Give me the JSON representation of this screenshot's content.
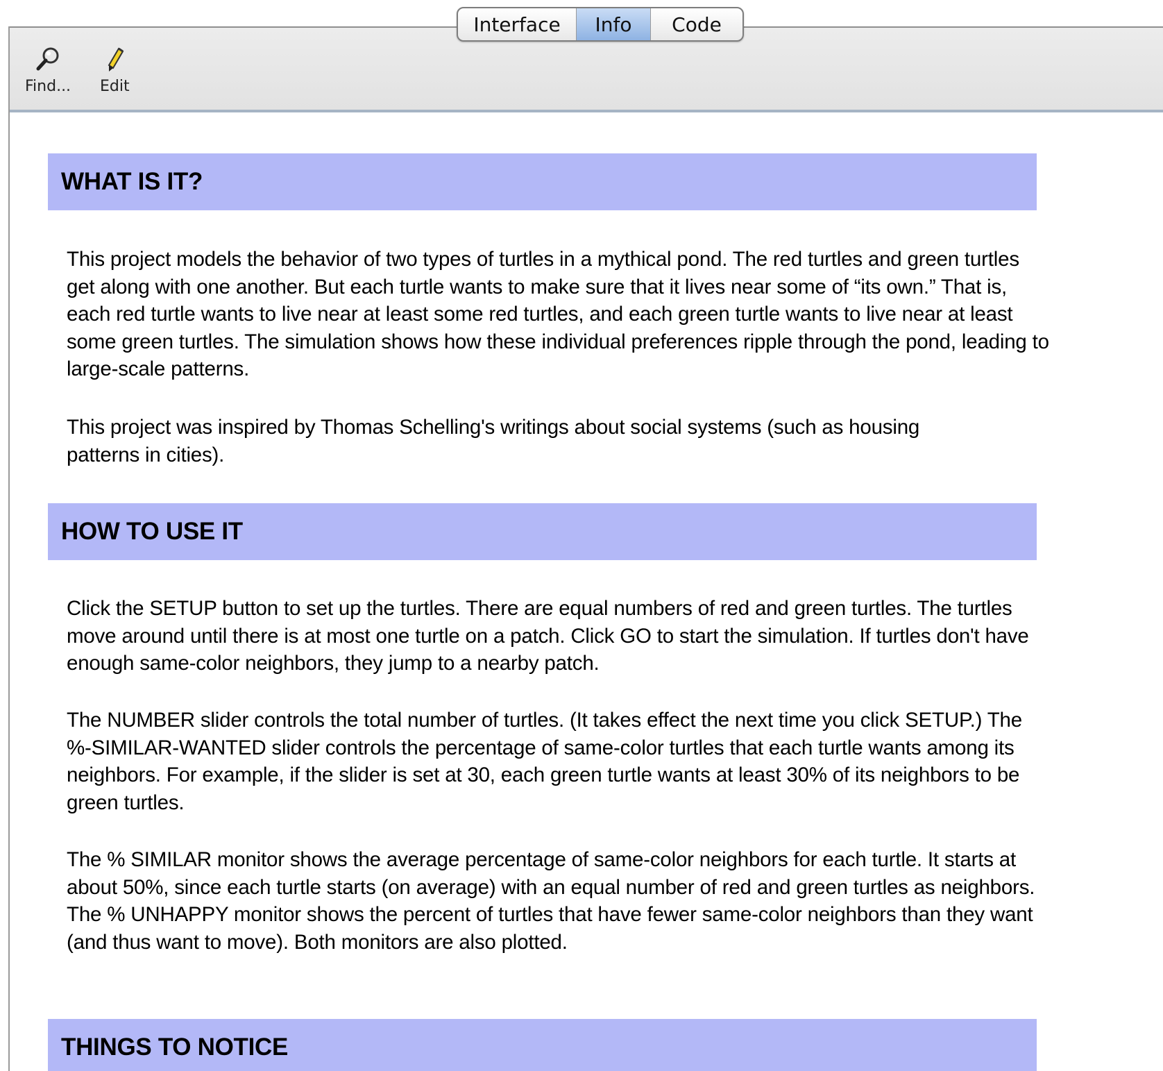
{
  "tabs": [
    {
      "label": "Interface",
      "active": false
    },
    {
      "label": "Info",
      "active": true
    },
    {
      "label": "Code",
      "active": false
    }
  ],
  "toolbar": {
    "find_label": "Find...",
    "edit_label": "Edit",
    "find_icon": "magnifier-icon",
    "edit_icon": "pencil-icon"
  },
  "sections": [
    {
      "heading": "WHAT IS IT?",
      "paragraphs": [
        "This project models the behavior of two types of turtles in a mythical pond. The red turtles and green turtles get along with one another. But each turtle wants to make sure that it lives near some of “its own.” That is, each red turtle wants to live near at least some red turtles, and each green turtle wants to live near at least some green turtles. The simulation shows how these individual preferences ripple through the pond, leading to large-scale patterns.",
        "This project was inspired by Thomas Schelling's writings about social systems (such as housing patterns in cities)."
      ]
    },
    {
      "heading": "HOW TO USE IT",
      "paragraphs": [
        "Click the SETUP button to set up the turtles. There are equal numbers of red and green turtles. The turtles move around until there is at most one turtle on a patch. Click GO to start the simulation. If turtles don't have enough same-color neighbors, they jump to a nearby patch.",
        "The NUMBER slider controls the total number of turtles. (It takes effect the next time you click SETUP.) The %-SIMILAR-WANTED slider controls the percentage of same-color turtles that each turtle wants among its neighbors. For example, if the slider is set at 30, each green turtle wants at least 30% of its neighbors to be green turtles.",
        "The % SIMILAR monitor shows the average percentage of same-color neighbors for each turtle. It starts at about 50%, since each turtle starts (on average) with an equal number of red and green turtles as neighbors. The % UNHAPPY monitor shows the percent of turtles that have fewer same-color neighbors than they want (and thus want to move). Both monitors are also plotted."
      ]
    },
    {
      "heading": "THINGS TO NOTICE",
      "paragraphs": []
    }
  ],
  "colors": {
    "section_header_bg": "#b3b8f7",
    "active_tab": "#a9c6ec"
  }
}
